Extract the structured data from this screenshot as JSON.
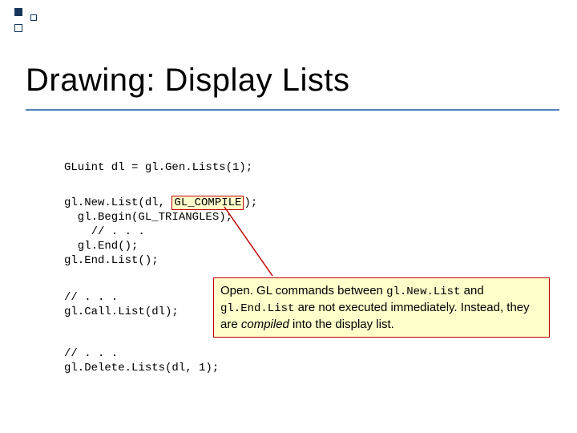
{
  "title": "Drawing:  Display Lists",
  "code": {
    "block1": "GLuint dl = gl.Gen.Lists(1);",
    "block2_pre": "gl.New.List(dl, ",
    "block2_hl": "GL_COMPILE",
    "block2_post": ");\n  gl.Begin(GL_TRIANGLES);\n    // . . .\n  gl.End();\ngl.End.List();",
    "block3": "// . . .\ngl.Call.List(dl);",
    "block4": "// . . .\ngl.Delete.Lists(dl, 1);"
  },
  "callout": {
    "t1": "Open. GL commands between ",
    "m1": "gl.New.List",
    "t2": " and ",
    "m2": "gl.End.List",
    "t3": " are not executed immediately. Instead, they are ",
    "i1": "compiled",
    "t4": " into the display list."
  }
}
